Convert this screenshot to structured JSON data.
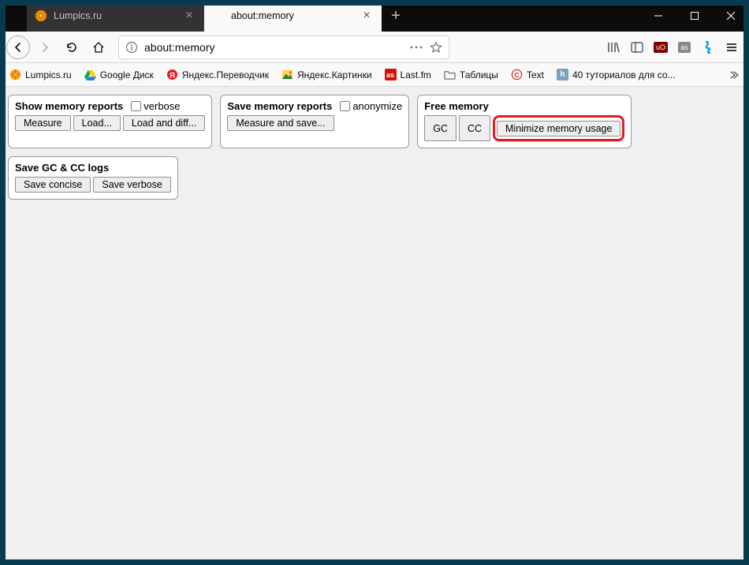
{
  "tabs": [
    {
      "title": "Lumpics.ru"
    },
    {
      "title": "about:memory"
    }
  ],
  "address": {
    "url": "about:memory"
  },
  "bookmarks": [
    {
      "label": "Lumpics.ru"
    },
    {
      "label": "Google Диск"
    },
    {
      "label": "Яндекс.Переводчик"
    },
    {
      "label": "Яндекс.Картинки"
    },
    {
      "label": "Last.fm"
    },
    {
      "label": "Таблицы"
    },
    {
      "label": "Text"
    },
    {
      "label": "40 туториалов для со..."
    }
  ],
  "memory": {
    "show": {
      "title": "Show memory reports",
      "verbose_label": "verbose",
      "measure": "Measure",
      "load": "Load...",
      "load_diff": "Load and diff..."
    },
    "save": {
      "title": "Save memory reports",
      "anonymize_label": "anonymize",
      "measure_save": "Measure and save..."
    },
    "free": {
      "title": "Free memory",
      "gc": "GC",
      "cc": "CC",
      "minimize": "Minimize memory usage"
    },
    "logs": {
      "title": "Save GC & CC logs",
      "concise": "Save concise",
      "verbose": "Save verbose"
    }
  }
}
